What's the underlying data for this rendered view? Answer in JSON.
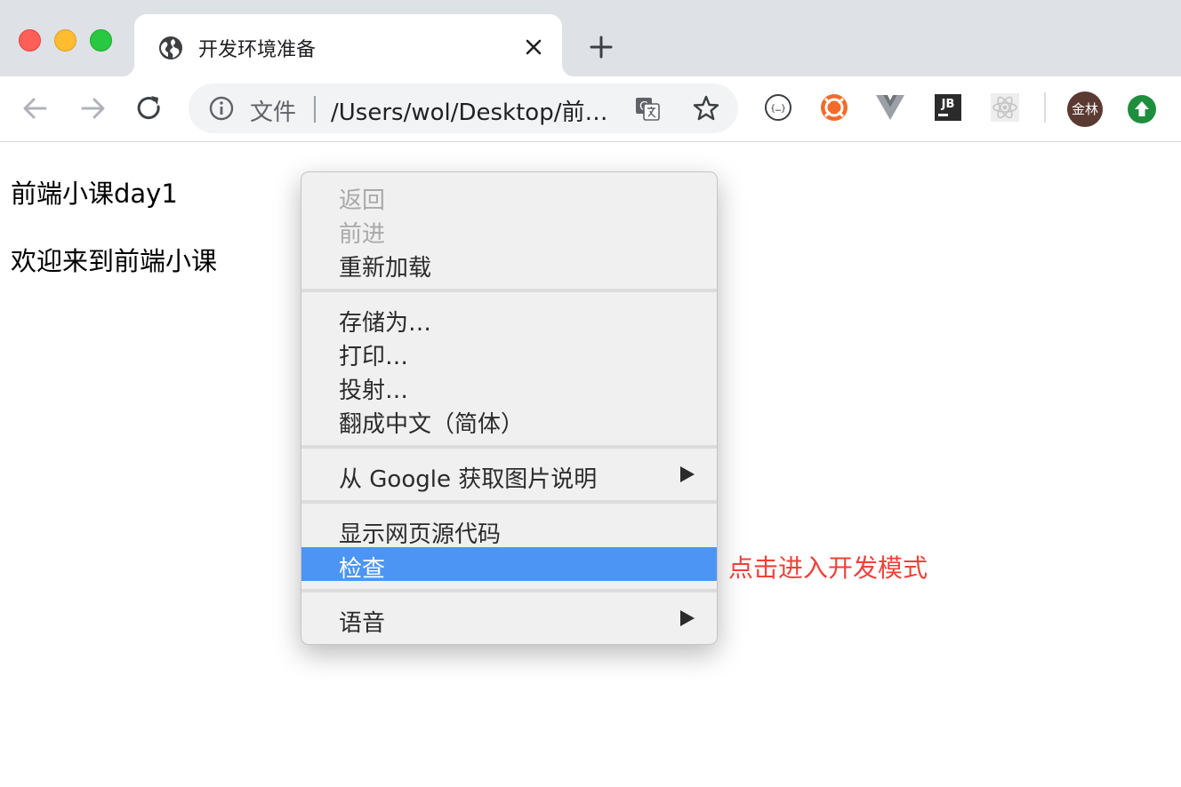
{
  "window": {
    "tab_title": "开发环境准备"
  },
  "toolbar": {
    "url_scheme": "文件",
    "url_text": "/Users/wol/Desktop/前…",
    "avatar_text": "金林",
    "jb_label": "JB",
    "json_label": "{…}"
  },
  "page": {
    "heading": "前端小课day1",
    "paragraph": "欢迎来到前端小课"
  },
  "context_menu": {
    "back": "返回",
    "forward": "前进",
    "reload": "重新加载",
    "save_as": "存储为…",
    "print": "打印…",
    "cast": "投射…",
    "translate": "翻成中文（简体）",
    "image_desc": "从 Google 获取图片说明",
    "view_source": "显示网页源代码",
    "inspect": "检查",
    "speech": "语音"
  },
  "annotation": {
    "text": "点击进入开发模式",
    "color": "#f0403a"
  },
  "colors": {
    "menu_highlight": "#4c95f5",
    "tabstrip": "#dee1e6"
  }
}
